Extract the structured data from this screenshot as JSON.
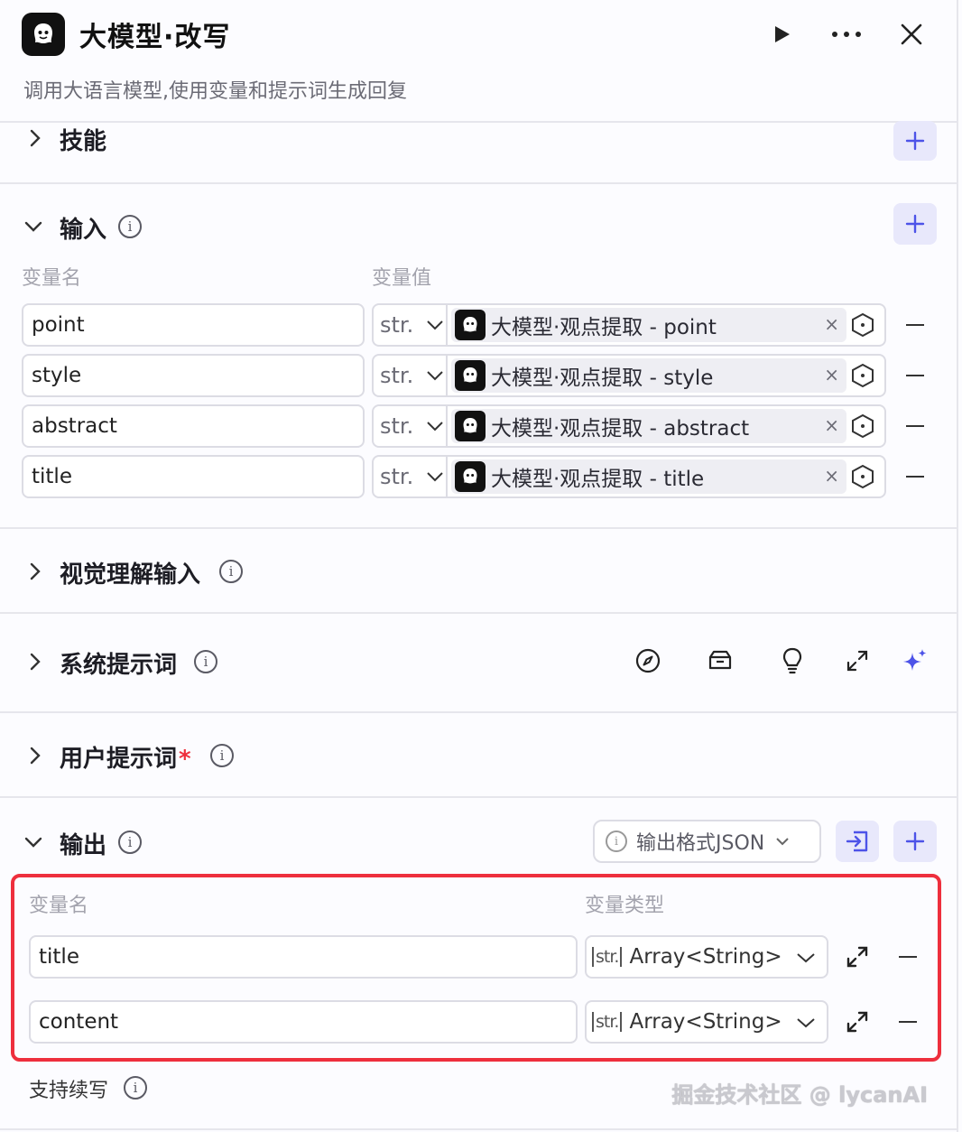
{
  "header": {
    "title": "大模型·改写",
    "description": "调用大语言模型,使用变量和提示词生成回复",
    "icons": [
      "robot-logo-icon",
      "play-icon",
      "more-icon",
      "close-icon"
    ]
  },
  "skills": {
    "title": "技能"
  },
  "input": {
    "title": "输入",
    "col_name": "变量名",
    "col_value": "变量值",
    "type_label": "str.",
    "rows": [
      {
        "name": "point",
        "ref_source": "大模型·观点提取",
        "ref_sep": " - ",
        "ref_var": "point"
      },
      {
        "name": "style",
        "ref_source": "大模型·观点提取",
        "ref_sep": " - ",
        "ref_var": "style"
      },
      {
        "name": "abstract",
        "ref_source": "大模型·观点提取",
        "ref_sep": " - ",
        "ref_var": "abstract"
      },
      {
        "name": "title",
        "ref_source": "大模型·观点提取",
        "ref_sep": " - ",
        "ref_var": "title"
      }
    ],
    "remove_glyph": "×"
  },
  "vision": {
    "title": "视觉理解输入"
  },
  "system_prompt": {
    "title": "系统提示词",
    "toolbar_icons": [
      "compass-icon",
      "library-icon",
      "lightbulb-icon",
      "expand-icon",
      "sparkle-icon"
    ]
  },
  "user_prompt": {
    "title": "用户提示词",
    "required_mark": "*"
  },
  "output": {
    "title": "输出",
    "format_button": "输出格式JSON",
    "col_name": "变量名",
    "col_type": "变量类型",
    "type_tag": "str.",
    "rows": [
      {
        "name": "title",
        "type": "Array<String>"
      },
      {
        "name": "content",
        "type": "Array<String>"
      }
    ]
  },
  "footer": {
    "continue_label": "支持续写",
    "watermark": "掘金技术社区 @ lycanAI"
  },
  "colors": {
    "accent": "#4d53e8",
    "highlight_border": "#ee2f3d",
    "required": "#ee2f3d"
  }
}
